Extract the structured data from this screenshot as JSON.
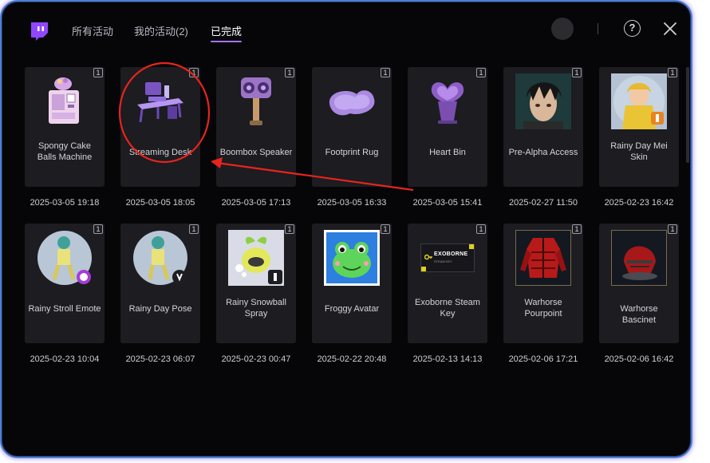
{
  "header": {
    "logo_icon": "twitch-logo-icon",
    "tabs": [
      {
        "label": "所有活动",
        "active": false
      },
      {
        "label": "我的活动(2)",
        "active": false
      },
      {
        "label": "已完成",
        "active": true
      }
    ],
    "help_symbol": "?",
    "close_icon": "close-icon"
  },
  "accent_color": "#a970ff",
  "items": [
    {
      "name": "Spongy Cake Balls Machine",
      "date": "2025-03-05 19:18",
      "count": "1",
      "icon": "cake-machine-icon"
    },
    {
      "name": "Streaming Desk",
      "date": "2025-03-05 18:05",
      "count": "1",
      "icon": "streaming-desk-icon"
    },
    {
      "name": "Boombox Speaker",
      "date": "2025-03-05 17:13",
      "count": "1",
      "icon": "boombox-speaker-icon"
    },
    {
      "name": "Footprint Rug",
      "date": "2025-03-05 16:33",
      "count": "1",
      "icon": "footprint-rug-icon"
    },
    {
      "name": "Heart Bin",
      "date": "2025-03-05 15:41",
      "count": "1",
      "icon": "heart-bin-icon"
    },
    {
      "name": "Pre-Alpha Access",
      "date": "2025-02-27 11:50",
      "count": "1",
      "icon": "anime-character-portrait-icon"
    },
    {
      "name": "Rainy Day Mei Skin",
      "date": "2025-02-23 16:42",
      "count": "1",
      "icon": "mei-skin-portrait-icon"
    },
    {
      "name": "Rainy Stroll Emote",
      "date": "2025-02-23 10:04",
      "count": "1",
      "icon": "emote-character-icon"
    },
    {
      "name": "Rainy Day Pose",
      "date": "2025-02-23 06:07",
      "count": "1",
      "icon": "pose-character-icon"
    },
    {
      "name": "Rainy Snowball Spray",
      "date": "2025-02-23 00:47",
      "count": "1",
      "icon": "snowball-spray-icon"
    },
    {
      "name": "Froggy Avatar",
      "date": "2025-02-22 20:48",
      "count": "1",
      "icon": "frog-avatar-icon"
    },
    {
      "name": "Exoborne Steam Key",
      "date": "2025-02-13 14:13",
      "count": "1",
      "icon": "steam-key-card-icon",
      "key_text": "EXOBORNE",
      "key_subtext": "STEAM KEY"
    },
    {
      "name": "Warhorse Pourpoint",
      "date": "2025-02-06 17:21",
      "count": "1",
      "icon": "red-jacket-icon"
    },
    {
      "name": "Warhorse Bascinet",
      "date": "2025-02-06 16:42",
      "count": "1",
      "icon": "red-helmet-icon"
    }
  ],
  "annotation": {
    "color": "#e8241c",
    "shapes": [
      "red-ellipse-highlight",
      "red-arrow"
    ]
  }
}
